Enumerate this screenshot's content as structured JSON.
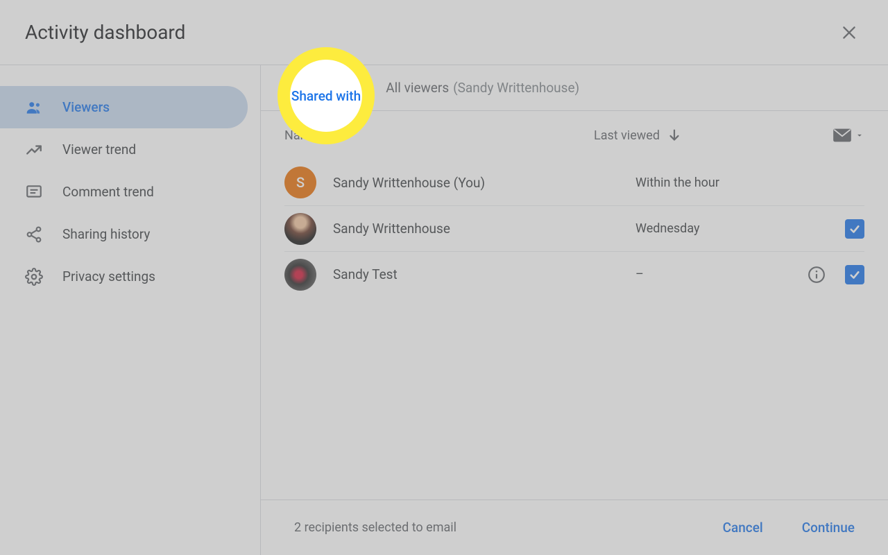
{
  "header": {
    "title": "Activity dashboard"
  },
  "sidebar": {
    "items": [
      {
        "label": "Viewers"
      },
      {
        "label": "Viewer trend"
      },
      {
        "label": "Comment trend"
      },
      {
        "label": "Sharing history"
      },
      {
        "label": "Privacy settings"
      }
    ]
  },
  "tabs": {
    "shared_with": "Shared with",
    "all_viewers": "All viewers",
    "all_viewers_sub": "(Sandy Writtenhouse)"
  },
  "table": {
    "col_name": "Name",
    "col_last_viewed": "Last viewed",
    "rows": [
      {
        "name": "Sandy Writtenhouse (You)",
        "last_viewed": "Within the hour",
        "avatar_letter": "S"
      },
      {
        "name": "Sandy Writtenhouse",
        "last_viewed": "Wednesday"
      },
      {
        "name": "Sandy Test",
        "last_viewed": "–"
      }
    ]
  },
  "footer": {
    "status": "2 recipients selected to email",
    "cancel": "Cancel",
    "continue": "Continue"
  }
}
